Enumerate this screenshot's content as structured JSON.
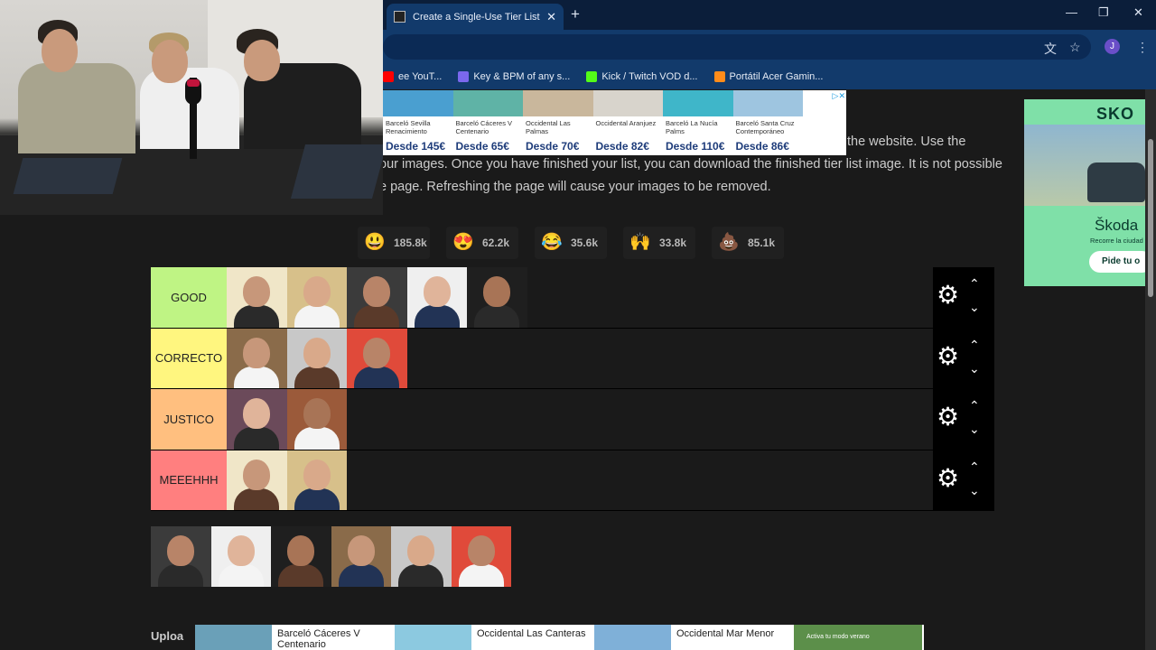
{
  "browser": {
    "tab_title": "Create a Single-Use Tier List (Pr",
    "tab_close": "✕",
    "new_tab": "+",
    "window_controls": [
      "—",
      "❐",
      "✕"
    ],
    "avatar_initial": "J",
    "bookmarks": [
      {
        "label": "ee YouT...",
        "color": "#ff0000"
      },
      {
        "label": "Key & BPM of any s...",
        "color": "#7b68ee"
      },
      {
        "label": "Kick / Twitch VOD d...",
        "color": "#53fc18"
      },
      {
        "label": "Portátil Acer Gamin...",
        "color": "#ff8c1a"
      }
    ]
  },
  "page": {
    "description_lines": [
      "the website. Use the",
      "our images. Once you have finished your list, you can download the finished tier list image. It is not possible",
      "e page. Refreshing the page will cause your images to be removed."
    ],
    "reactions": [
      {
        "emoji": "😃",
        "count": "185.8k"
      },
      {
        "emoji": "😍",
        "count": "62.2k"
      },
      {
        "emoji": "😂",
        "count": "35.6k"
      },
      {
        "emoji": "🙌",
        "count": "33.8k"
      },
      {
        "emoji": "💩",
        "count": "85.1k"
      }
    ],
    "tiers": [
      {
        "label": "GOOD",
        "color": "#bff484",
        "items": 5
      },
      {
        "label": "CORRECTO",
        "color": "#fff67f",
        "items": 3
      },
      {
        "label": "JUSTICO",
        "color": "#ffbf7f",
        "items": 2
      },
      {
        "label": "MEEEHHH",
        "color": "#ff7f7f",
        "items": 2
      }
    ],
    "tier_controls": {
      "gear": "⚙",
      "up": "⌃",
      "down": "⌄"
    },
    "pool_count": 6,
    "upload_label": "Uploa"
  },
  "ads": {
    "top": [
      {
        "name": "Barceló Sevilla Renacimiento",
        "price": "Desde 145€",
        "color": "#4a9fd0"
      },
      {
        "name": "Barceló Cáceres V Centenario",
        "price": "Desde 65€",
        "color": "#5fb3a6"
      },
      {
        "name": "Occidental Las Palmas",
        "price": "Desde 70€",
        "color": "#c9b79c"
      },
      {
        "name": "Occidental Aranjuez",
        "price": "Desde 82€",
        "color": "#d8d4cc"
      },
      {
        "name": "Barceló La Nucía Palms",
        "price": "Desde 110€",
        "color": "#3fb6c9"
      },
      {
        "name": "Barceló Santa Cruz Contemporáneo",
        "price": "Desde 86€",
        "color": "#9ec5e0"
      }
    ],
    "right": {
      "brand": "SKO",
      "name": "Škoda",
      "sub": "Recorre la ciudad",
      "cta": "Pide tu o"
    },
    "bottom": [
      {
        "name": "Barceló Cáceres V Centenario",
        "color": "#6aa0b8"
      },
      {
        "name": "Occidental Las Canteras",
        "color": "#8cc9e0"
      },
      {
        "name": "Occidental Mar Menor",
        "color": "#7fb0d8"
      }
    ],
    "bottom_last": "Activa tu modo verano"
  }
}
